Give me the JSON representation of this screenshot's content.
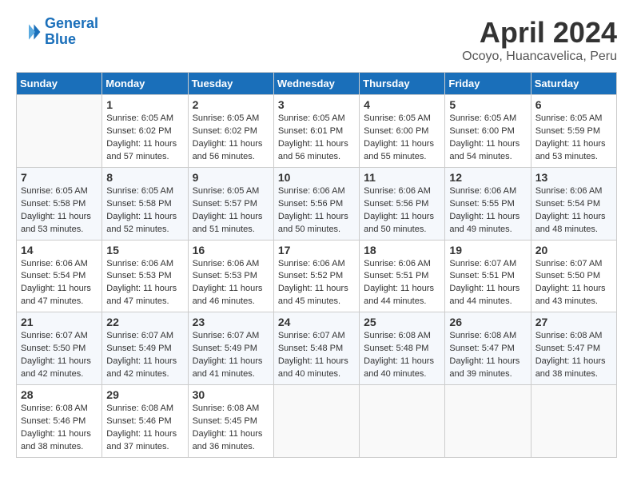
{
  "header": {
    "logo_line1": "General",
    "logo_line2": "Blue",
    "title": "April 2024",
    "subtitle": "Ocoyo, Huancavelica, Peru"
  },
  "weekdays": [
    "Sunday",
    "Monday",
    "Tuesday",
    "Wednesday",
    "Thursday",
    "Friday",
    "Saturday"
  ],
  "weeks": [
    [
      {
        "num": "",
        "empty": true
      },
      {
        "num": "1",
        "rise": "6:05 AM",
        "set": "6:02 PM",
        "daylight": "11 hours and 57 minutes."
      },
      {
        "num": "2",
        "rise": "6:05 AM",
        "set": "6:02 PM",
        "daylight": "11 hours and 56 minutes."
      },
      {
        "num": "3",
        "rise": "6:05 AM",
        "set": "6:01 PM",
        "daylight": "11 hours and 56 minutes."
      },
      {
        "num": "4",
        "rise": "6:05 AM",
        "set": "6:00 PM",
        "daylight": "11 hours and 55 minutes."
      },
      {
        "num": "5",
        "rise": "6:05 AM",
        "set": "6:00 PM",
        "daylight": "11 hours and 54 minutes."
      },
      {
        "num": "6",
        "rise": "6:05 AM",
        "set": "5:59 PM",
        "daylight": "11 hours and 53 minutes."
      }
    ],
    [
      {
        "num": "7",
        "rise": "6:05 AM",
        "set": "5:58 PM",
        "daylight": "11 hours and 53 minutes."
      },
      {
        "num": "8",
        "rise": "6:05 AM",
        "set": "5:58 PM",
        "daylight": "11 hours and 52 minutes."
      },
      {
        "num": "9",
        "rise": "6:05 AM",
        "set": "5:57 PM",
        "daylight": "11 hours and 51 minutes."
      },
      {
        "num": "10",
        "rise": "6:06 AM",
        "set": "5:56 PM",
        "daylight": "11 hours and 50 minutes."
      },
      {
        "num": "11",
        "rise": "6:06 AM",
        "set": "5:56 PM",
        "daylight": "11 hours and 50 minutes."
      },
      {
        "num": "12",
        "rise": "6:06 AM",
        "set": "5:55 PM",
        "daylight": "11 hours and 49 minutes."
      },
      {
        "num": "13",
        "rise": "6:06 AM",
        "set": "5:54 PM",
        "daylight": "11 hours and 48 minutes."
      }
    ],
    [
      {
        "num": "14",
        "rise": "6:06 AM",
        "set": "5:54 PM",
        "daylight": "11 hours and 47 minutes."
      },
      {
        "num": "15",
        "rise": "6:06 AM",
        "set": "5:53 PM",
        "daylight": "11 hours and 47 minutes."
      },
      {
        "num": "16",
        "rise": "6:06 AM",
        "set": "5:53 PM",
        "daylight": "11 hours and 46 minutes."
      },
      {
        "num": "17",
        "rise": "6:06 AM",
        "set": "5:52 PM",
        "daylight": "11 hours and 45 minutes."
      },
      {
        "num": "18",
        "rise": "6:06 AM",
        "set": "5:51 PM",
        "daylight": "11 hours and 44 minutes."
      },
      {
        "num": "19",
        "rise": "6:07 AM",
        "set": "5:51 PM",
        "daylight": "11 hours and 44 minutes."
      },
      {
        "num": "20",
        "rise": "6:07 AM",
        "set": "5:50 PM",
        "daylight": "11 hours and 43 minutes."
      }
    ],
    [
      {
        "num": "21",
        "rise": "6:07 AM",
        "set": "5:50 PM",
        "daylight": "11 hours and 42 minutes."
      },
      {
        "num": "22",
        "rise": "6:07 AM",
        "set": "5:49 PM",
        "daylight": "11 hours and 42 minutes."
      },
      {
        "num": "23",
        "rise": "6:07 AM",
        "set": "5:49 PM",
        "daylight": "11 hours and 41 minutes."
      },
      {
        "num": "24",
        "rise": "6:07 AM",
        "set": "5:48 PM",
        "daylight": "11 hours and 40 minutes."
      },
      {
        "num": "25",
        "rise": "6:08 AM",
        "set": "5:48 PM",
        "daylight": "11 hours and 40 minutes."
      },
      {
        "num": "26",
        "rise": "6:08 AM",
        "set": "5:47 PM",
        "daylight": "11 hours and 39 minutes."
      },
      {
        "num": "27",
        "rise": "6:08 AM",
        "set": "5:47 PM",
        "daylight": "11 hours and 38 minutes."
      }
    ],
    [
      {
        "num": "28",
        "rise": "6:08 AM",
        "set": "5:46 PM",
        "daylight": "11 hours and 38 minutes."
      },
      {
        "num": "29",
        "rise": "6:08 AM",
        "set": "5:46 PM",
        "daylight": "11 hours and 37 minutes."
      },
      {
        "num": "30",
        "rise": "6:08 AM",
        "set": "5:45 PM",
        "daylight": "11 hours and 36 minutes."
      },
      {
        "num": "",
        "empty": true
      },
      {
        "num": "",
        "empty": true
      },
      {
        "num": "",
        "empty": true
      },
      {
        "num": "",
        "empty": true
      }
    ]
  ]
}
